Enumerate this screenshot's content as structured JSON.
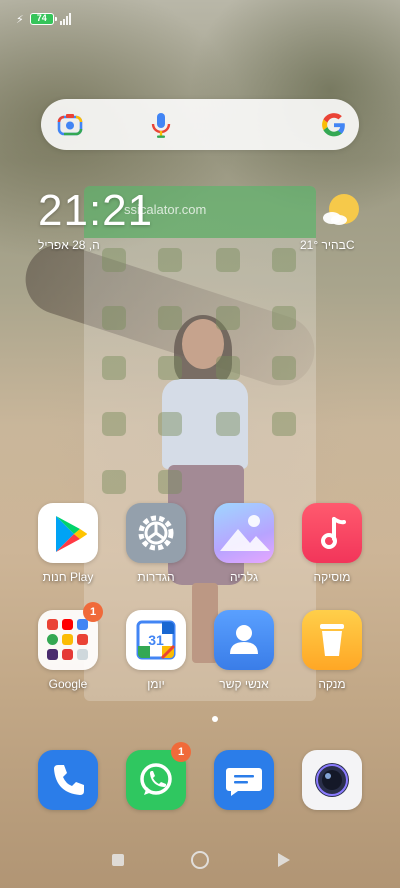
{
  "status_bar": {
    "battery_level": "74"
  },
  "search_bar": {
    "icons": [
      "google-lens-icon",
      "microphone-icon",
      "google-logo-icon"
    ]
  },
  "clock_widget": {
    "time": "21:21",
    "date": "ה, 28 אפריל",
    "temperature": "21°C",
    "weather_condition": "בהיר",
    "weather_icon": "partly-sunny-icon"
  },
  "overlay_app": {
    "watermark": "ssicalator.com"
  },
  "home_apps": [
    {
      "label": "חנות Play",
      "icon": "play-store-icon"
    },
    {
      "label": "הגדרות",
      "icon": "settings-gear-icon"
    },
    {
      "label": "גלריה",
      "icon": "gallery-icon"
    },
    {
      "label": "מוסיקה",
      "icon": "music-icon"
    },
    {
      "label": "Google",
      "icon": "google-folder-icon",
      "badge": "1"
    },
    {
      "label": "יומן",
      "icon": "calendar-icon",
      "day": "31"
    },
    {
      "label": "אנשי קשר",
      "icon": "contacts-icon"
    },
    {
      "label": "מנקה",
      "icon": "cleaner-icon"
    }
  ],
  "dock": [
    {
      "icon": "phone-icon"
    },
    {
      "icon": "whatsapp-icon",
      "badge": "1"
    },
    {
      "icon": "messages-icon"
    },
    {
      "icon": "camera-icon"
    }
  ],
  "nav_bar": {
    "buttons": [
      "recent-apps",
      "home",
      "back"
    ]
  },
  "colors": {
    "battery": "#36c45a",
    "badge": "#f06a3a",
    "overlay_green": "#3caa50"
  }
}
